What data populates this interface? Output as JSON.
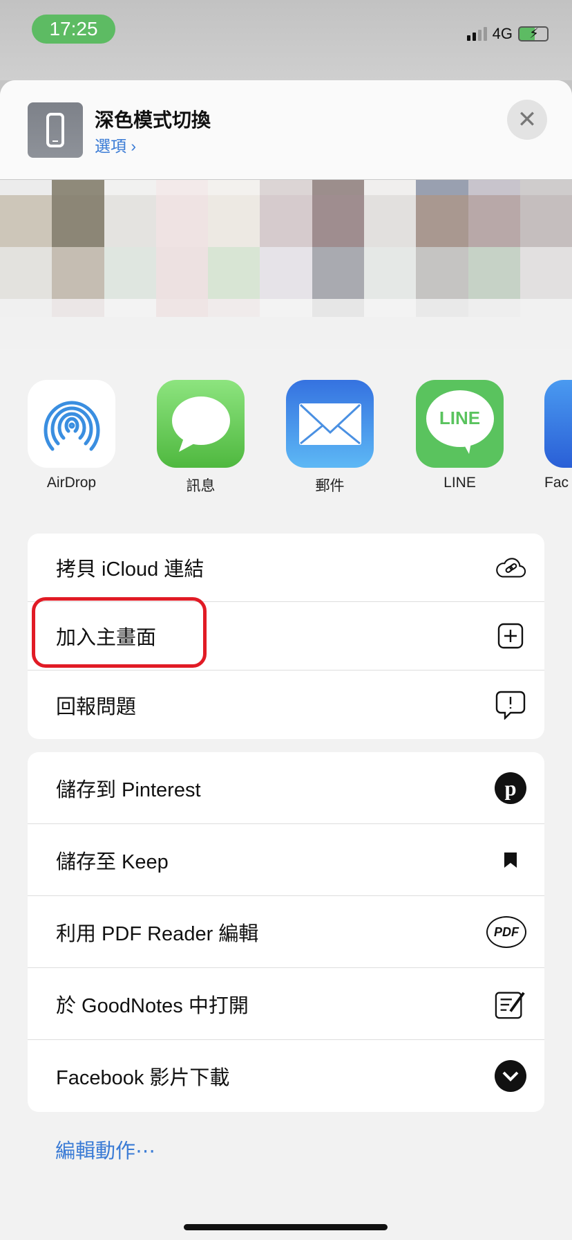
{
  "status_bar": {
    "time": "17:25",
    "network": "4G",
    "battery_charging": true,
    "time_pill_color": "#5dbb63"
  },
  "header": {
    "title": "深色模式切換",
    "options_label": "選項 ›",
    "close_icon": "close-icon"
  },
  "share_targets": [
    {
      "label": "AirDrop",
      "icon": "airdrop-icon"
    },
    {
      "label": "訊息",
      "icon": "messages-icon"
    },
    {
      "label": "郵件",
      "icon": "mail-icon",
      "glyph": ""
    },
    {
      "label": "LINE",
      "icon": "line-icon",
      "glyph": "LINE"
    },
    {
      "label": "Fac",
      "icon": "facebook-icon"
    }
  ],
  "actions_group1": [
    {
      "label": "拷貝 iCloud 連結",
      "icon": "icloud-link-icon"
    },
    {
      "label": "加入主畫面",
      "icon": "add-square-icon",
      "highlighted": true
    },
    {
      "label": "回報問題",
      "icon": "report-bubble-icon"
    }
  ],
  "actions_group2": [
    {
      "label": "儲存到 Pinterest",
      "icon": "pinterest-icon"
    },
    {
      "label": "儲存至 Keep",
      "icon": "bookmark-icon"
    },
    {
      "label": "利用 PDF Reader 編輯",
      "icon": "pdf-icon",
      "glyph": "PDF"
    },
    {
      "label": "於 GoodNotes 中打開",
      "icon": "goodnotes-icon"
    },
    {
      "label": "Facebook 影片下載",
      "icon": "chevron-down-circle-icon"
    }
  ],
  "edit_actions": "編輯動作⋯",
  "colors": {
    "accent": "#3a7bd5",
    "highlight": "#e11b25"
  }
}
